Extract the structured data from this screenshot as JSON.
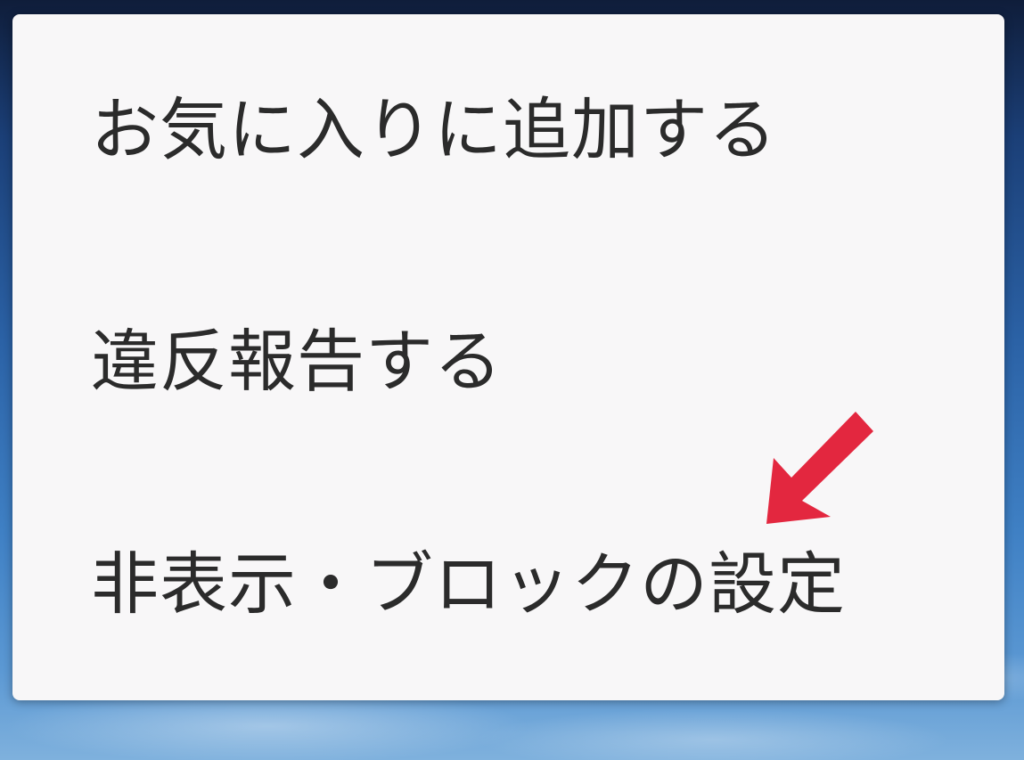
{
  "menu": {
    "items": [
      {
        "label": "お気に入りに追加する"
      },
      {
        "label": "違反報告する"
      },
      {
        "label": "非表示・ブロックの設定"
      }
    ]
  },
  "annotation": {
    "icon": "red-arrow-icon",
    "color": "#e3273f",
    "points_to": "非表示・ブロックの設定"
  },
  "colors": {
    "panel_background": "#f8f7f8",
    "text": "#2b2b2b"
  }
}
